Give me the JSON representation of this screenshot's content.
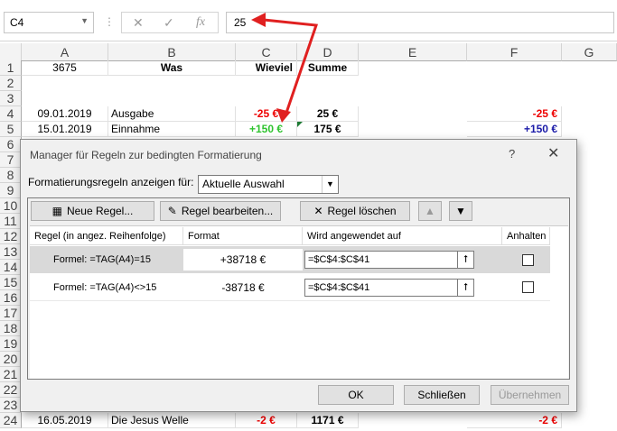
{
  "formula_bar": {
    "name_box": "C4",
    "value": "25",
    "icons": [
      "cancel-icon",
      "enter-icon",
      "function-icon"
    ]
  },
  "columns": [
    "A",
    "B",
    "C",
    "D",
    "E",
    "F",
    "G"
  ],
  "rows": [
    "1",
    "2",
    "3",
    "4",
    "5",
    "6",
    "7",
    "8",
    "9",
    "10",
    "11",
    "12",
    "13",
    "14",
    "15",
    "16",
    "17",
    "18",
    "19",
    "20",
    "21",
    "22",
    "23",
    "24"
  ],
  "cells": {
    "r1": {
      "a": "3675",
      "b": "Was",
      "c": "Wieviel",
      "d": "Summe"
    },
    "r4": {
      "a": "09.01.2019",
      "b": "Ausgabe",
      "c": "-25 €",
      "d": "25 €",
      "f": "-25 €"
    },
    "r5": {
      "a": "15.01.2019",
      "b": "Einnahme",
      "c": "+150 €",
      "d": "175 €",
      "f": "+150 €"
    },
    "r24": {
      "a": "16.05.2019",
      "b": "Die Jesus Welle",
      "c": "-2 €",
      "d": "1171 €",
      "f": "-2 €"
    }
  },
  "dialog": {
    "title": "Manager für Regeln zur bedingten Formatierung",
    "help": "?",
    "close": "✕",
    "show_label": "Formatierungsregeln anzeigen für:",
    "show_value": "Aktuelle Auswahl",
    "buttons": {
      "new_rule": "Neue Regel...",
      "edit_rule": "Regel bearbeiten...",
      "delete_rule": "Regel löschen",
      "ok": "OK",
      "close": "Schließen",
      "apply": "Übernehmen"
    },
    "headers": {
      "rule": "Regel (in angez. Reihenfolge)",
      "format": "Format",
      "applies": "Wird angewendet auf",
      "stop": "Anhalten"
    },
    "rules": [
      {
        "rule": "Formel: =TAG(A4)=15",
        "format": "+38718 €",
        "applies": "=$C$4:$C$41",
        "stop": false
      },
      {
        "rule": "Formel: =TAG(A4)<>15",
        "format": "-38718 €",
        "applies": "=$C$4:$C$41",
        "stop": false
      }
    ]
  },
  "colors": {
    "accent_arrow": "#e02020",
    "negative": "#ee0000",
    "positive": "#2fc32f",
    "blue": "#1a1aa8"
  }
}
